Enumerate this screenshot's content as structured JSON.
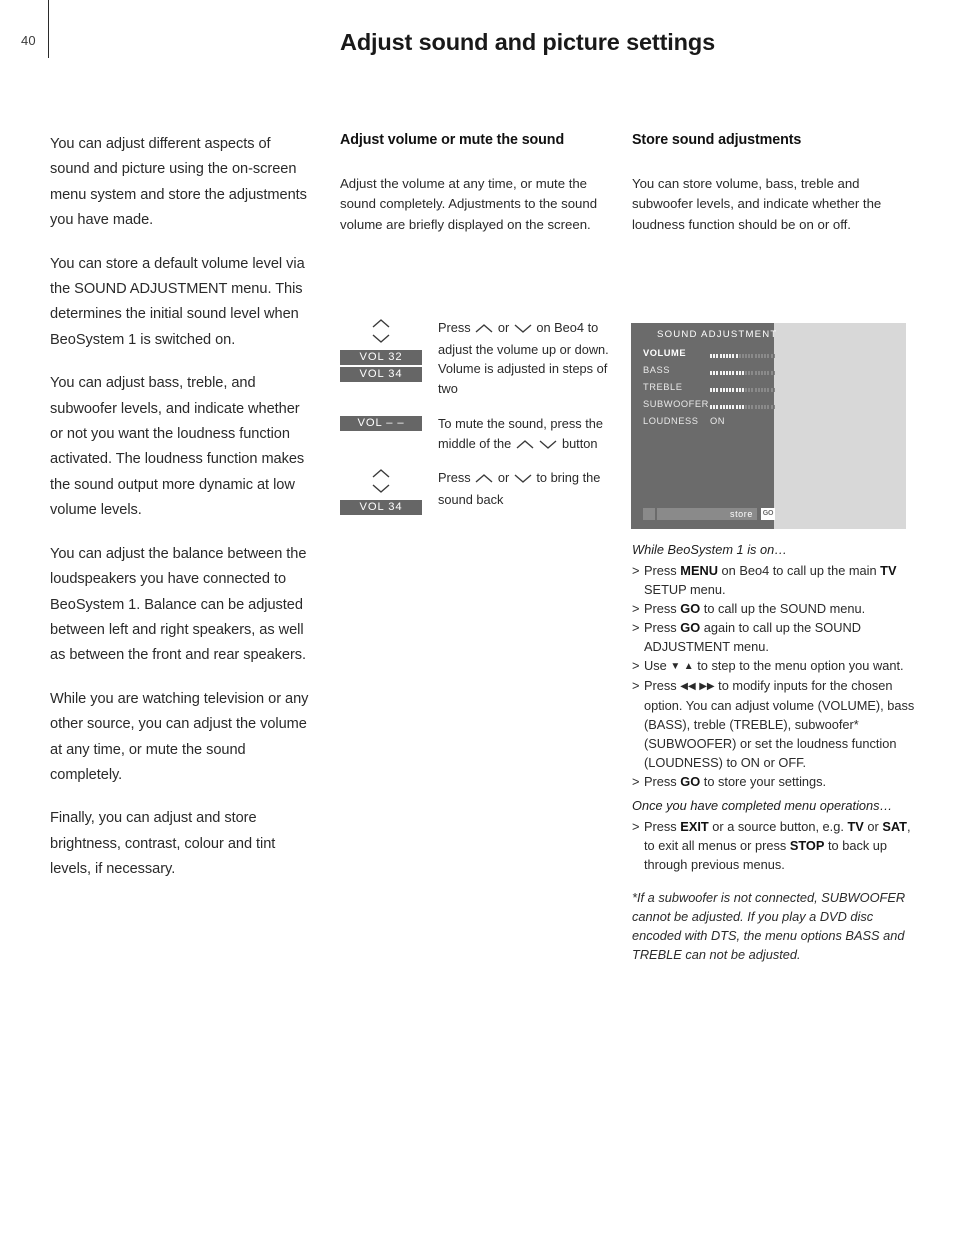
{
  "page": {
    "number": "40",
    "title": "Adjust sound and picture settings"
  },
  "left_column": {
    "paragraphs": [
      "You can adjust different aspects of sound and picture using the on-screen menu system and store the adjustments you have made.",
      "You can store a default volume level via the SOUND ADJUSTMENT menu. This determines the initial sound level when BeoSystem 1 is switched on.",
      "You can adjust bass, treble, and subwoofer levels, and indicate whether or not you want the loudness function activated. The loudness function makes the sound output more dynamic at low volume levels.",
      "You can adjust the balance between the loudspeakers you have connected to BeoSystem 1. Balance can be adjusted between left and right speakers, as well as between the front and rear speakers.",
      "While you are watching television or any other source, you can adjust the volume at any time, or mute the sound completely.",
      "Finally, you can adjust and store brightness, contrast, colour and tint levels, if necessary."
    ]
  },
  "middle_column": {
    "heading": "Adjust volume or mute the sound",
    "intro": "Adjust the volume at any time, or mute the sound completely. Adjustments to the sound volume are briefly displayed on the screen.",
    "steps": [
      {
        "keys": [
          "chevron-up-icon",
          "chevron-down-icon"
        ],
        "chips": [
          "VOL 32",
          "VOL 34"
        ],
        "text_parts": [
          {
            "type": "text",
            "value": "Press "
          },
          {
            "type": "icon",
            "value": "chevron-up-icon"
          },
          {
            "type": "text",
            "value": " or "
          },
          {
            "type": "icon",
            "value": "chevron-down-icon"
          },
          {
            "type": "text",
            "value": " on Beo4 to adjust the volume up or down. Volume is adjusted in steps of two"
          }
        ]
      },
      {
        "keys": [],
        "chips": [
          "VOL – –"
        ],
        "text_parts": [
          {
            "type": "text",
            "value": "To mute the sound, press the middle of the "
          },
          {
            "type": "icon",
            "value": "chevron-up-icon"
          },
          {
            "type": "text",
            "value": " "
          },
          {
            "type": "icon",
            "value": "chevron-down-icon"
          },
          {
            "type": "text",
            "value": " button"
          }
        ]
      },
      {
        "keys": [
          "chevron-up-icon",
          "chevron-down-icon"
        ],
        "chips": [
          "VOL 34"
        ],
        "text_parts": [
          {
            "type": "text",
            "value": "Press "
          },
          {
            "type": "icon",
            "value": "chevron-up-icon"
          },
          {
            "type": "text",
            "value": " or "
          },
          {
            "type": "icon",
            "value": "chevron-down-icon"
          },
          {
            "type": "text",
            "value": " to bring the sound back"
          }
        ]
      }
    ]
  },
  "right_column": {
    "heading": "Store sound adjustments",
    "intro": "You can store volume, bass, treble and subwoofer levels, and indicate whether the loudness function should be on or off.",
    "osd": {
      "title": "SOUND  ADJUSTMENT",
      "rows": [
        {
          "label": "VOLUME",
          "type": "bar",
          "active": true,
          "filled": 9,
          "total": 22
        },
        {
          "label": "BASS",
          "type": "bar",
          "active": false,
          "filled": 11,
          "total": 22
        },
        {
          "label": "TREBLE",
          "type": "bar",
          "active": false,
          "filled": 11,
          "total": 22
        },
        {
          "label": "SUBWOOFER",
          "type": "bar",
          "active": false,
          "filled": 11,
          "total": 22
        },
        {
          "label": "LOUDNESS",
          "type": "text",
          "active": false,
          "value": "ON"
        }
      ],
      "store_label": "store",
      "go_badge": "GO"
    },
    "procedure_1": {
      "heading": "While BeoSystem 1 is on…",
      "items": [
        "Press MENU on Beo4 to call up the main TV SETUP menu.",
        "Press GO to call up the SOUND menu.",
        "Press GO again to call up the SOUND ADJUSTMENT menu.",
        "Use ▼ ▲ to step to the menu option you want.",
        "Press ◀◀ ▶▶ to modify inputs for the chosen option. You can adjust volume (VOLUME), bass (BASS), treble (TREBLE), subwoofer* (SUBWOOFER) or set the loudness function (LOUDNESS) to ON or OFF.",
        "Press GO to store your settings."
      ]
    },
    "procedure_2": {
      "heading": "Once you have completed menu operations…",
      "items": [
        "Press EXIT or a source button, e.g. TV or SAT, to exit all menus or press STOP to back up through previous menus."
      ]
    },
    "footnote": "*If a subwoofer is not connected, SUBWOOFER cannot be adjusted. If you play a DVD disc encoded with DTS, the menu options BASS and TREBLE can not be adjusted."
  },
  "colors": {
    "chip_bg": "#666666",
    "osd_bg": "#6b6b6b",
    "osd_panel": "#d8d8d8",
    "text": "#2a2a2a"
  }
}
